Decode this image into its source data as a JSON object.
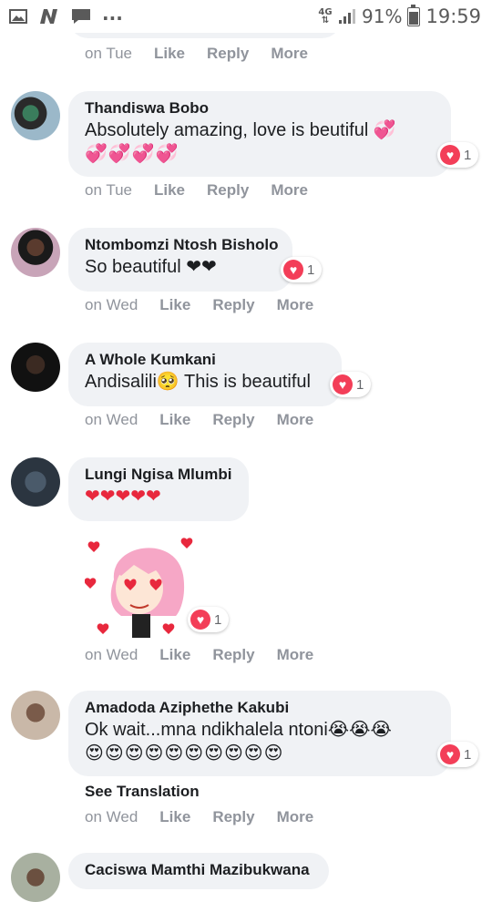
{
  "status_bar": {
    "left_icons": [
      "gallery-icon",
      "n-app-icon",
      "chat-icon"
    ],
    "more": "...",
    "network": "4G",
    "battery": "91%",
    "battery_level": 0.91,
    "time": "19:59"
  },
  "actions": {
    "like": "Like",
    "reply": "Reply",
    "more": "More"
  },
  "top_partial": {
    "time": "on Tue"
  },
  "comments": [
    {
      "author": "Thandiswa Bobo",
      "text": "Absolutely amazing, love is beutiful 💞",
      "emoji_line": "💞💞💞💞",
      "reaction_count": "1",
      "time": "on Tue"
    },
    {
      "author": "Ntombomzi Ntosh Bisholo",
      "text": "So beautiful ❤❤",
      "reaction_count": "1",
      "time": "on Wed"
    },
    {
      "author": "A Whole Kumkani",
      "text": "Andisalili🥺 This is beautiful",
      "reaction_count": "1",
      "time": "on Wed"
    },
    {
      "author": "Lungi Ngisa Mlumbi",
      "text": "❤❤❤❤❤",
      "sticker": "heart-eyes-girl-sticker",
      "reaction_count": "1",
      "time": "on Wed"
    },
    {
      "author": "Amadoda Aziphethe Kakubi",
      "text": "Ok wait...mna ndikhalela ntoni😭😭😭",
      "emoji_line": "😍😍😍😍😍😍😍😍😍😍",
      "reaction_count": "1",
      "see_translation": "See Translation",
      "time": "on Wed"
    },
    {
      "author": "Caciswa Mamthi Mazibukwana"
    }
  ],
  "colors": {
    "bubble": "#f0f2f5",
    "love_reaction": "#f33e58",
    "meta_text": "#90949c"
  }
}
